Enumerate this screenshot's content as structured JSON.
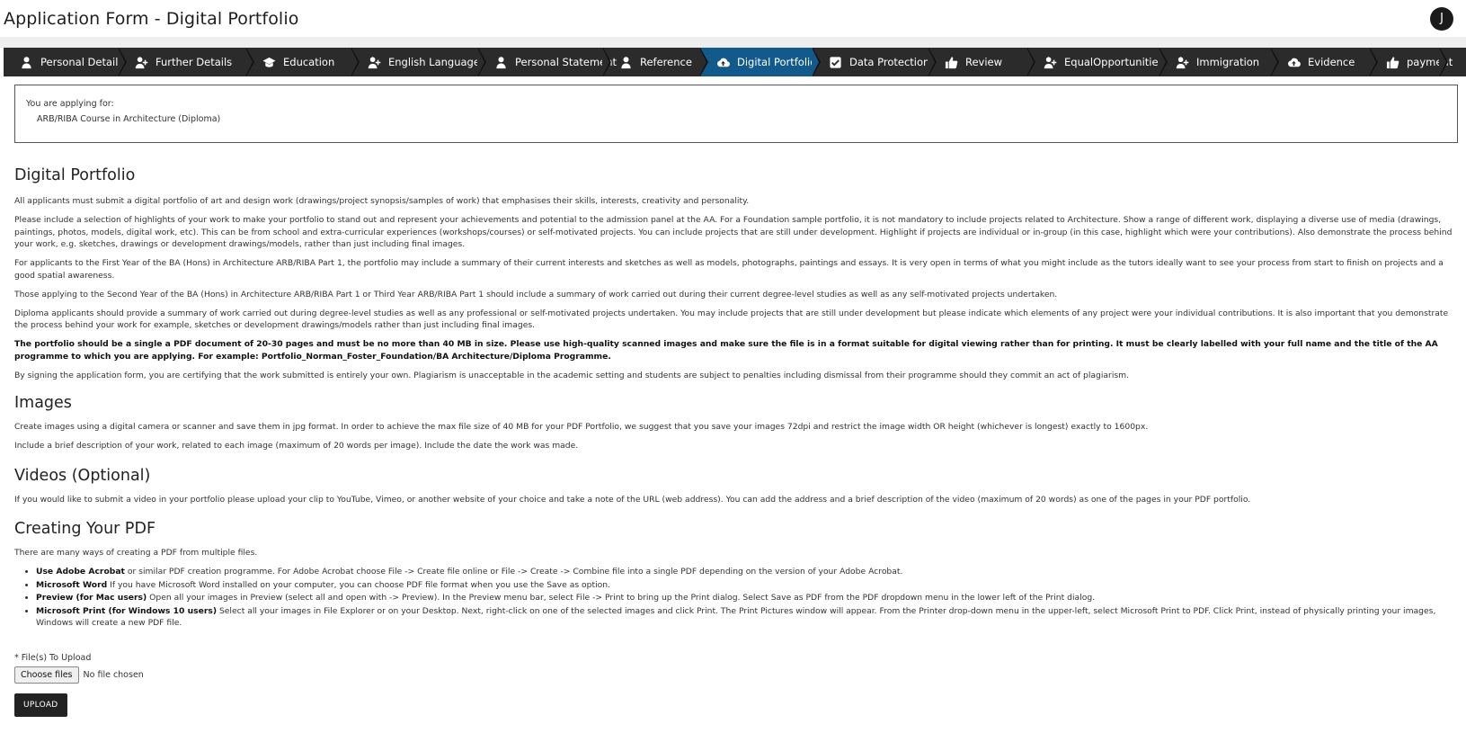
{
  "header": {
    "title": "Application Form - Digital Portfolio",
    "avatar_initial": "J"
  },
  "steps": [
    {
      "label": "Personal Details",
      "icon": "user-icon",
      "active": false
    },
    {
      "label": "Further Details",
      "icon": "user-plus-icon",
      "active": false
    },
    {
      "label": "Education",
      "icon": "graduation-cap-icon",
      "active": false
    },
    {
      "label": "English Language",
      "icon": "user-plus-icon",
      "active": false
    },
    {
      "label": "Personal Statement",
      "icon": "user-icon",
      "active": false
    },
    {
      "label": "Reference",
      "icon": "user-icon",
      "active": false
    },
    {
      "label": "Digital Portfolio",
      "icon": "cloud-upload-icon",
      "active": true
    },
    {
      "label": "Data Protection",
      "icon": "check-square-icon",
      "active": false
    },
    {
      "label": "Review",
      "icon": "thumbs-up-icon",
      "active": false
    },
    {
      "label": "EqualOpportunities",
      "icon": "user-plus-icon",
      "active": false
    },
    {
      "label": "Immigration",
      "icon": "user-plus-icon",
      "active": false
    },
    {
      "label": "Evidence",
      "icon": "cloud-upload-icon",
      "active": false
    },
    {
      "label": "payment",
      "icon": "thumbs-up-icon",
      "active": false
    }
  ],
  "applying": {
    "label": "You are applying for:",
    "course": "ARB/RIBA Course in Architecture (Diploma)"
  },
  "portfolio": {
    "heading": "Digital Portfolio",
    "p1": "All applicants must submit a digital portfolio of art and design work (drawings/project synopsis/samples of work) that emphasises their skills, interests, creativity and personality.",
    "p2": "Please include a selection of highlights of your work to make your portfolio to stand out and represent your achievements and potential to the admission panel at the AA. For a Foundation sample portfolio, it is not mandatory to include projects related to Architecture. Show a range of different work, displaying a diverse use of media (drawings, paintings, photos, models, digital work, etc). This can be from school and extra-curricular experiences (workshops/courses) or self-motivated projects. You can include projects that are still under development. Highlight if projects are individual or in-group (in this case, highlight which were your contributions). Also demonstrate the process behind your work, e.g. sketches, drawings or development drawings/models, rather than just including final images.",
    "p3": "For applicants to the First Year of the BA (Hons) in Architecture ARB/RIBA Part 1, the portfolio may include a summary of their current interests and sketches as well as models, photographs, paintings and essays. It is very open in terms of what you might include as the tutors ideally want to see your process from start to finish on projects and a good spatial awareness.",
    "p4": "Those applying to the Second Year of the BA (Hons) in Architecture ARB/RIBA Part 1 or Third Year ARB/RIBA Part 1 should include a summary of work carried out during their current degree-level studies as well as any self-motivated projects undertaken.",
    "p5": "Diploma applicants should provide a summary of work carried out during degree-level studies as well as any professional or self-motivated projects undertaken. You may include projects that are still under development but please indicate which elements of any project were your individual contributions. It is also important that you demonstrate the process behind your work for example, sketches or development drawings/models rather than just including final images.",
    "p6_bold": "The portfolio should be a single a PDF document of 20-30 pages and must be no more than 40 MB in size. Please use high-quality scanned images and make sure the file is in a format suitable for digital viewing rather than for printing. It must be clearly labelled with your full name and the title of the AA programme to which you are applying. For example: Portfolio_Norman_Foster_Foundation/BA Architecture/Diploma Programme.",
    "p7": "By signing the application form, you are certifying that the work submitted is entirely your own. Plagiarism is unacceptable in the academic setting and students are subject to penalties including dismissal from their programme should they commit an act of plagiarism."
  },
  "images": {
    "heading": "Images",
    "p1": "Create images using a digital camera or scanner and save them in jpg format. In order to achieve the max file size of 40 MB for your PDF Portfolio, we suggest that you save your images 72dpi and restrict the image width OR height (whichever is longest) exactly to 1600px.",
    "p2": "Include a brief description of your work, related to each image (maximum of 20 words per image). Include the date the work was made."
  },
  "videos": {
    "heading": "Videos (Optional)",
    "p1": "If you would like to submit a video in your portfolio please upload your clip to YouTube, Vimeo, or another website of your choice and take a note of the URL (web address). You can add the address and a brief description of the video (maximum of 20 words) as one of the pages in your PDF portfolio."
  },
  "pdf": {
    "heading": "Creating Your PDF",
    "intro": "There are many ways of creating a PDF from multiple files.",
    "items": [
      {
        "title": "Use Adobe Acrobat",
        "text": " or similar PDF creation programme. For Adobe Acrobat choose File -> Create file online or File -> Create -> Combine file into a single PDF depending on the version of your Adobe Acrobat."
      },
      {
        "title": "Microsoft Word",
        "text": " If you have Microsoft Word installed on your computer, you can choose PDF file format when you use the Save as option."
      },
      {
        "title": "Preview (for Mac users)",
        "text": " Open all your images in Preview (select all and open with -> Preview). In the Preview menu bar, select File -> Print to bring up the Print dialog. Select Save as PDF from the PDF dropdown menu in the lower left of the Print dialog."
      },
      {
        "title": "Microsoft Print (for Windows 10 users)",
        "text": " Select all your images in File Explorer or on your Desktop. Next, right-click on one of the selected images and click Print. The Print Pictures window will appear. From the Printer drop-down menu in the upper-left, select Microsoft Print to PDF. Click Print, instead of physically printing your images, Windows will create a new PDF file."
      }
    ]
  },
  "upload": {
    "label": "* File(s) To Upload",
    "choose_label": "Choose files",
    "no_file": "No file chosen",
    "button": "UPLOAD"
  }
}
